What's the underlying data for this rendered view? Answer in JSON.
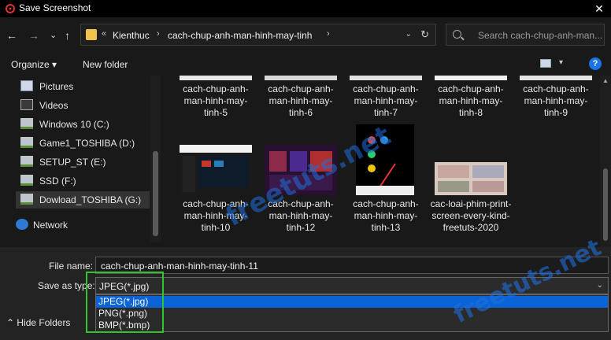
{
  "window": {
    "title": "Save Screenshot",
    "close_label": "✕"
  },
  "nav": {
    "back": "←",
    "forward": "→",
    "recent": "⌄",
    "up": "↑",
    "breadcrumb_overflow": "«",
    "crumbs": [
      "Kienthuc",
      "cach-chup-anh-man-hinh-may-tinh"
    ],
    "search_placeholder": "Search cach-chup-anh-man..."
  },
  "toolbar": {
    "organize": "Organize ▾",
    "new_folder": "New folder",
    "help": "?"
  },
  "sidebar": {
    "items": [
      {
        "label": "Pictures",
        "icon": "pictures-icon"
      },
      {
        "label": "Videos",
        "icon": "videos-icon"
      },
      {
        "label": "Windows 10 (C:)",
        "icon": "drive-icon"
      },
      {
        "label": "Game1_TOSHIBA (D:)",
        "icon": "drive-icon"
      },
      {
        "label": "SETUP_ST (E:)",
        "icon": "drive-icon"
      },
      {
        "label": "SSD (F:)",
        "icon": "drive-icon"
      },
      {
        "label": "Dowload_TOSHIBA (G:)",
        "icon": "drive-icon",
        "selected": true
      }
    ],
    "network": "Network"
  },
  "files": {
    "row1": [
      "cach-chup-anh-man-hinh-may-tinh-5",
      "cach-chup-anh-man-hinh-may-tinh-6",
      "cach-chup-anh-man-hinh-may-tinh-7",
      "cach-chup-anh-man-hinh-may-tinh-8",
      "cach-chup-anh-man-hinh-may-tinh-9"
    ],
    "row2": [
      "cach-chup-anh-man-hinh-may-tinh-10",
      "cach-chup-anh-man-hinh-may-tinh-12",
      "cach-chup-anh-man-hinh-may-tinh-13",
      "cac-loai-phim-print-screen-every-kind-freetuts-2020"
    ]
  },
  "form": {
    "file_name_label": "File name:",
    "file_name_value": "cach-chup-anh-man-hinh-may-tinh-11",
    "save_type_label": "Save as type:",
    "save_type_value": "JPEG(*.jpg)",
    "type_options": [
      "JPEG(*.jpg)",
      "PNG(*.png)",
      "BMP(*.bmp)"
    ],
    "selected_option_index": 0
  },
  "hide_folders": "Hide Folders",
  "watermark": "freetuts.net",
  "colors": {
    "highlight_green": "#2fc52f",
    "selection_blue": "#0a64d8"
  }
}
